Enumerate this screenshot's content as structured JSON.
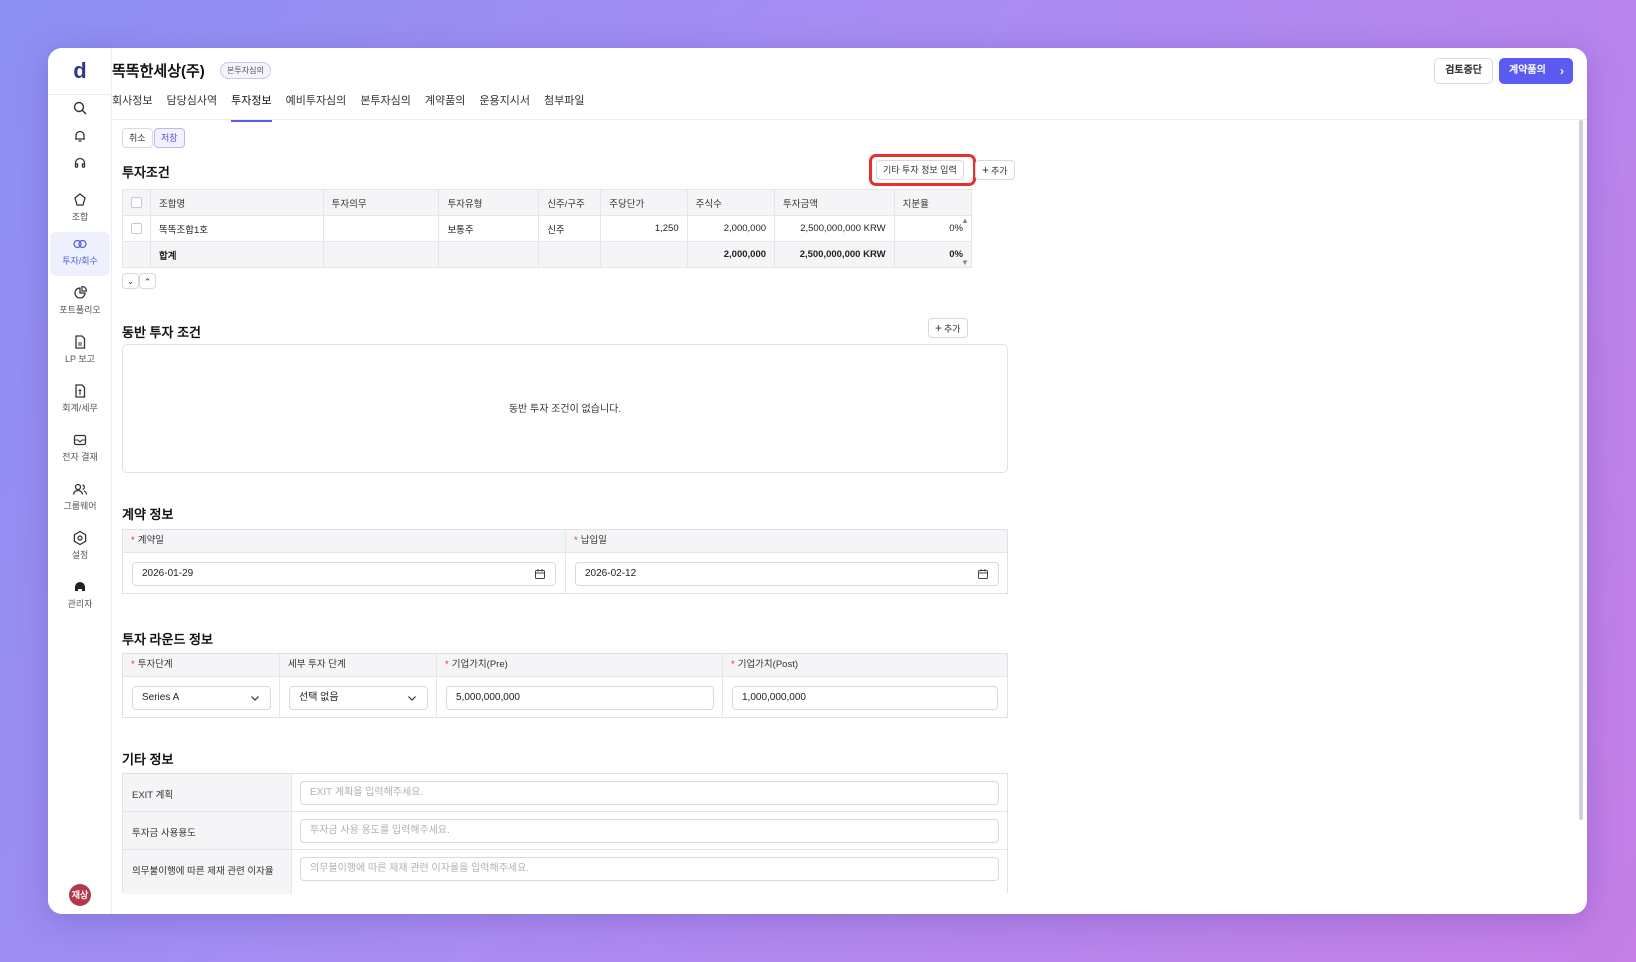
{
  "app": {
    "logo": "d"
  },
  "sidebar": {
    "items": [
      {
        "label": "조합",
        "icon": "fund-icon"
      },
      {
        "label": "투자/회수",
        "icon": "investment-icon"
      },
      {
        "label": "포트폴리오",
        "icon": "portfolio-icon"
      },
      {
        "label": "LP 보고",
        "icon": "report-icon"
      },
      {
        "label": "회계/세무",
        "icon": "accounting-icon"
      },
      {
        "label": "전자 결재",
        "icon": "approval-icon"
      },
      {
        "label": "그룹웨어",
        "icon": "groupware-icon"
      },
      {
        "label": "설정",
        "icon": "settings-icon"
      },
      {
        "label": "관리자",
        "icon": "admin-icon"
      }
    ],
    "avatar": "재상"
  },
  "header": {
    "title": "똑똑한세상(주)",
    "badge": "본투자심의",
    "stop_button": "검토중단",
    "contract_button": "계약품의"
  },
  "tabs": [
    "회사정보",
    "담당심사역",
    "투자정보",
    "예비투자심의",
    "본투자심의",
    "계약품의",
    "운용지시서",
    "첨부파일"
  ],
  "active_tab": "투자정보",
  "actions": {
    "cancel": "취소",
    "save": "저장"
  },
  "investment_terms": {
    "title": "투자조건",
    "extra_button": "기타 투자 정보 입력",
    "add_button": "추가",
    "columns": [
      "조합명",
      "투자의무",
      "투자유형",
      "신주/구주",
      "주당단가",
      "주식수",
      "투자금액",
      "지분율"
    ],
    "rows": [
      {
        "fund": "똑똑조합1호",
        "obligation": "",
        "type": "보통주",
        "new_old": "신주",
        "price": "1,250",
        "shares": "2,000,000",
        "amount": "2,500,000,000 KRW",
        "ratio": "0%"
      }
    ],
    "total": {
      "label": "합계",
      "shares": "2,000,000",
      "amount": "2,500,000,000 KRW",
      "ratio": "0%"
    }
  },
  "co_investment": {
    "title": "동반 투자 조건",
    "add_button": "추가",
    "empty_text": "동반 투자 조건이 없습니다."
  },
  "contract": {
    "title": "계약 정보",
    "contract_date_label": "계약일",
    "contract_date": "2026-01-29",
    "payment_date_label": "납입일",
    "payment_date": "2026-02-12"
  },
  "round": {
    "title": "투자 라운드 정보",
    "stage_label": "투자단계",
    "stage_value": "Series A",
    "sub_stage_label": "세부 투자 단계",
    "sub_stage_value": "선택 없음",
    "pre_label": "기업가치(Pre)",
    "pre_value": "5,000,000,000",
    "post_label": "기업가치(Post)",
    "post_value": "1,000,000,000"
  },
  "other": {
    "title": "기타 정보",
    "rows": [
      {
        "label": "EXIT 계획",
        "placeholder": "EXIT 계획을 입력해주세요."
      },
      {
        "label": "투자금 사용용도",
        "placeholder": "투자금 사용 용도를 입력해주세요."
      },
      {
        "label": "의무불이행에 따른 제재 관련 이자율",
        "placeholder": "의무불이행에 따른 제재 관련 이자율을 입력해주세요."
      }
    ]
  },
  "colors": {
    "accent": "#5b5bf2",
    "highlight": "#e8302a",
    "required": "#e8302a"
  }
}
